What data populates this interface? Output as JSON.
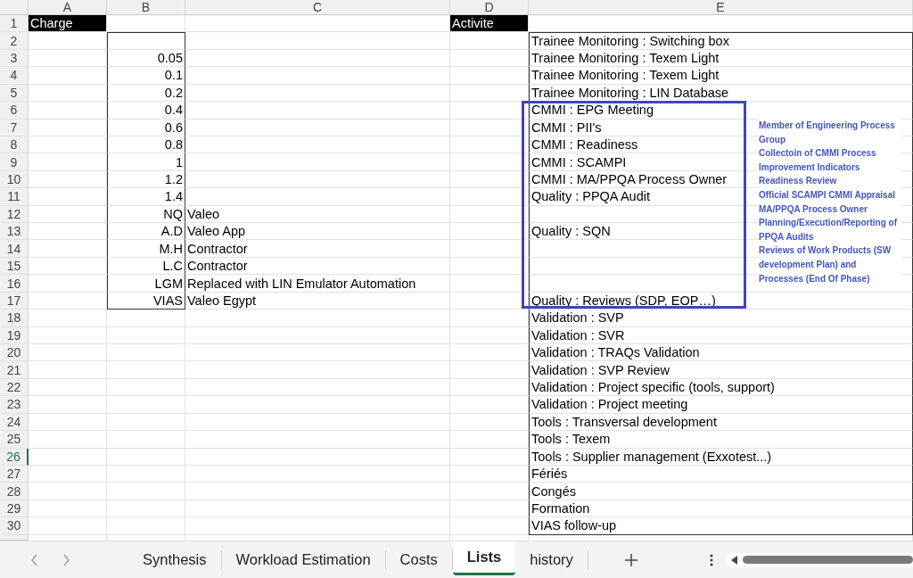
{
  "columns": [
    "A",
    "B",
    "C",
    "D",
    "E"
  ],
  "rows": [
    {
      "number": "1",
      "selected": false,
      "kind": "header",
      "A": "Charge",
      "D": "Activite"
    },
    {
      "number": "2",
      "selected": false,
      "kind": "data",
      "E": "Trainee Monitoring : Switching box"
    },
    {
      "number": "3",
      "selected": false,
      "kind": "data",
      "B": "0.05",
      "E": "Trainee Monitoring : Texem Light"
    },
    {
      "number": "4",
      "selected": false,
      "kind": "data",
      "B": "0.1",
      "E": "Trainee Monitoring : Texem Light"
    },
    {
      "number": "5",
      "selected": false,
      "kind": "data",
      "B": "0.2",
      "E": "Trainee Monitoring : LIN Database"
    },
    {
      "number": "6",
      "selected": false,
      "kind": "data",
      "B": "0.4",
      "E": "CMMI : EPG Meeting"
    },
    {
      "number": "7",
      "selected": false,
      "kind": "data",
      "B": "0.6",
      "E": "CMMI : PII's"
    },
    {
      "number": "8",
      "selected": false,
      "kind": "data",
      "B": "0.8",
      "E": "CMMI : Readiness"
    },
    {
      "number": "9",
      "selected": false,
      "kind": "data",
      "B": "1",
      "E": "CMMI : SCAMPI"
    },
    {
      "number": "10",
      "selected": false,
      "kind": "data",
      "B": "1.2",
      "E": "CMMI : MA/PPQA Process Owner"
    },
    {
      "number": "11",
      "selected": false,
      "kind": "data",
      "B": "1.4",
      "E": "Quality : PPQA Audit"
    },
    {
      "number": "12",
      "selected": false,
      "kind": "data",
      "B": "NQ",
      "C": "Valeo"
    },
    {
      "number": "13",
      "selected": false,
      "kind": "data",
      "B": "A.D",
      "C": "Valeo App",
      "E": "Quality : SQN"
    },
    {
      "number": "14",
      "selected": false,
      "kind": "data",
      "B": "M.H",
      "C": "Contractor"
    },
    {
      "number": "15",
      "selected": false,
      "kind": "data",
      "B": "L.C",
      "C": "Contractor"
    },
    {
      "number": "16",
      "selected": false,
      "kind": "data",
      "B": "LGM",
      "C": "Replaced with LIN Emulator Automation"
    },
    {
      "number": "17",
      "selected": false,
      "kind": "data",
      "B": "VIAS",
      "C": "Valeo Egypt",
      "E": "Quality : Reviews (SDP, EOP…)"
    },
    {
      "number": "18",
      "selected": false,
      "kind": "data",
      "E": "Validation : SVP"
    },
    {
      "number": "19",
      "selected": false,
      "kind": "data",
      "E": "Validation : SVR"
    },
    {
      "number": "20",
      "selected": false,
      "kind": "data",
      "E": "Validation : TRAQs Validation"
    },
    {
      "number": "21",
      "selected": false,
      "kind": "data",
      "E": "Validation : SVP Review"
    },
    {
      "number": "22",
      "selected": false,
      "kind": "data",
      "E": "Validation : Project specific (tools, support)"
    },
    {
      "number": "23",
      "selected": false,
      "kind": "data",
      "E": "Validation : Project meeting"
    },
    {
      "number": "24",
      "selected": false,
      "kind": "data",
      "E": "Tools : Transversal development"
    },
    {
      "number": "25",
      "selected": false,
      "kind": "data",
      "E": "Tools : Texem"
    },
    {
      "number": "26",
      "selected": true,
      "kind": "data",
      "E": "Tools : Supplier management (Exxotest...)"
    },
    {
      "number": "27",
      "selected": false,
      "kind": "data",
      "E": "Fériés"
    },
    {
      "number": "28",
      "selected": false,
      "kind": "data",
      "E": "Congés"
    },
    {
      "number": "29",
      "selected": false,
      "kind": "data",
      "E": "Formation"
    },
    {
      "number": "30",
      "selected": false,
      "kind": "data",
      "E": "VIAS follow-up"
    }
  ],
  "annotation": {
    "notes": [
      "Member of Engineering Process Group",
      "Collectoin of CMMI Process Improvement Indicators",
      "Readiness Review",
      "Official SCAMPI CMMI Appraisal",
      "MA/PPQA Process Owner Planning/Execution/Reporting of PPQA Audits",
      "Reviews of Work Products (SW development Plan) and Processes (End Of Phase)"
    ]
  },
  "sheet_tabs": [
    {
      "label": "Synthesis",
      "selected": false
    },
    {
      "label": "Workload Estimation",
      "selected": false
    },
    {
      "label": "Costs",
      "selected": false
    },
    {
      "label": "Lists",
      "selected": true
    },
    {
      "label": "history",
      "selected": false
    }
  ]
}
